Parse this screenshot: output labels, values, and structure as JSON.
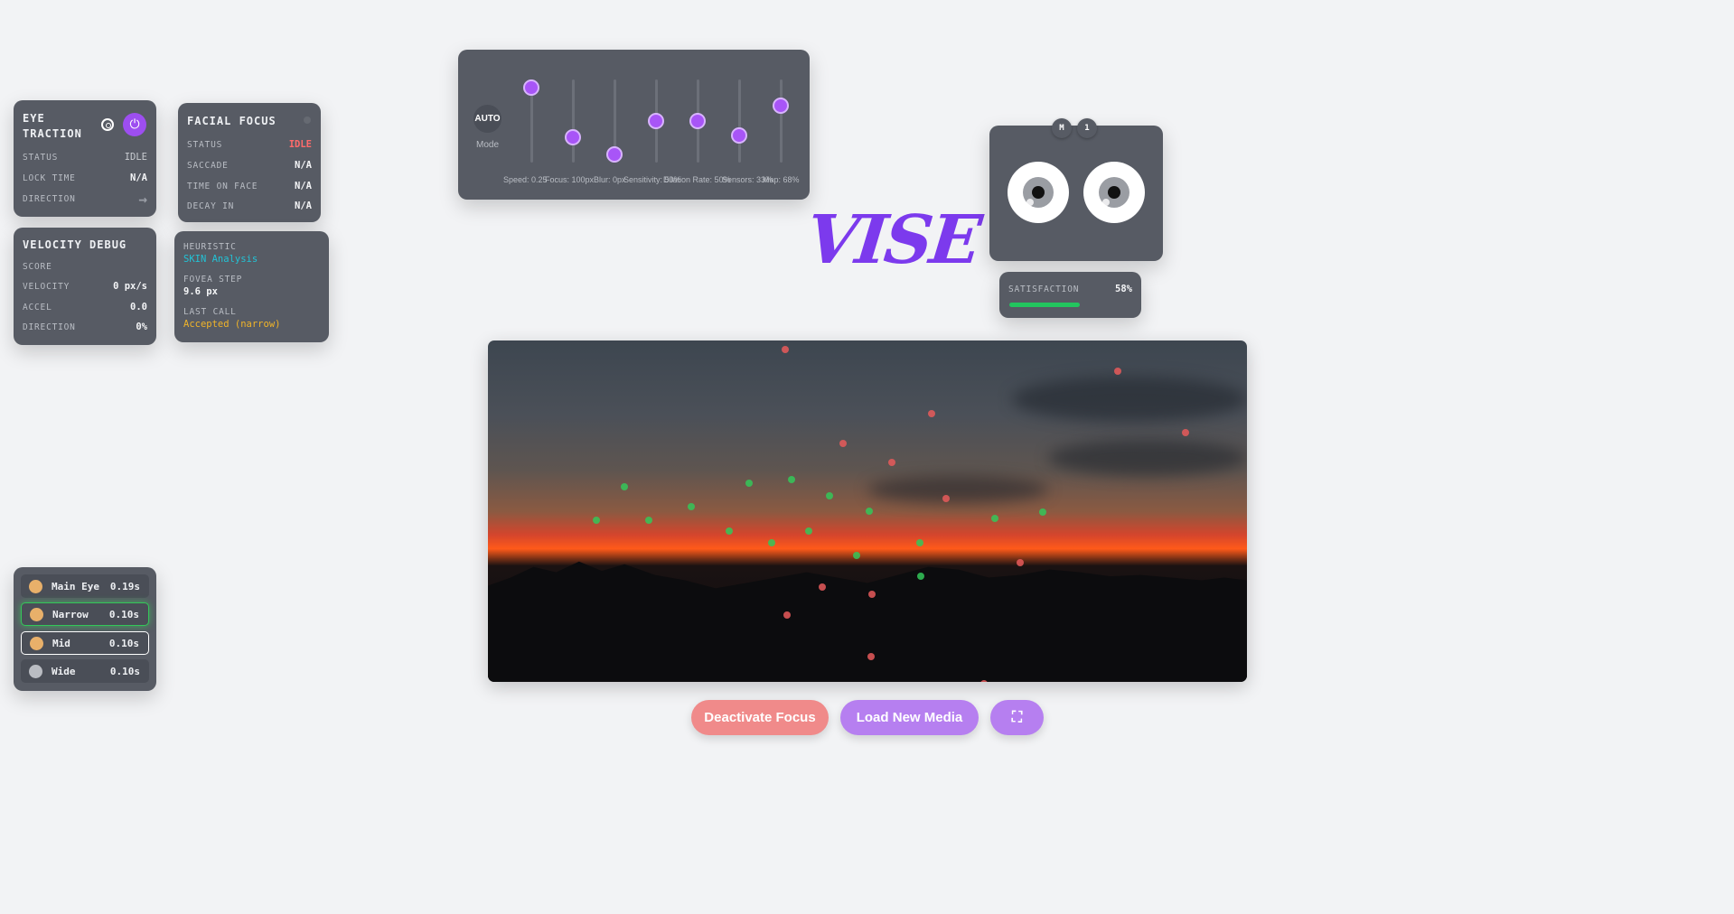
{
  "eye_traction": {
    "title": "EYE TRACTION",
    "rows": [
      {
        "label": "STATUS",
        "value": "IDLE"
      },
      {
        "label": "LOCK TIME",
        "value": "N/A"
      },
      {
        "label": "DIRECTION",
        "value": "→"
      }
    ]
  },
  "facial_focus": {
    "title": "FACIAL FOCUS",
    "rows": [
      {
        "label": "STATUS",
        "value": "IDLE"
      },
      {
        "label": "SACCADE",
        "value": "N/A"
      },
      {
        "label": "TIME ON FACE",
        "value": "N/A"
      },
      {
        "label": "DECAY IN",
        "value": "N/A"
      }
    ]
  },
  "velocity_debug": {
    "title": "VELOCITY DEBUG",
    "rows": [
      {
        "label": "SCORE",
        "value": ""
      },
      {
        "label": "VELOCITY",
        "value": "0 px/s"
      },
      {
        "label": "ACCEL",
        "value": "0.0"
      },
      {
        "label": "DIRECTION",
        "value": "0%"
      }
    ]
  },
  "heuristic": {
    "heuristic_label": "HEURISTIC",
    "heuristic_value": "SKIN Analysis",
    "fovea_label": "FOVEA STEP",
    "fovea_value": "9.6 px",
    "last_call_label": "LAST CALL",
    "last_call_value": "Accepted (narrow)"
  },
  "lenses": [
    {
      "name": "Main Eye",
      "time": "0.19s",
      "color": "#e8b06a"
    },
    {
      "name": "Narrow",
      "time": "0.10s",
      "color": "#e8b06a"
    },
    {
      "name": "Mid",
      "time": "0.10s",
      "color": "#e8b06a"
    },
    {
      "name": "Wide",
      "time": "0.10s",
      "color": "#b9bcc2"
    }
  ],
  "sliders": {
    "auto_label": "AUTO",
    "mode_label": "Mode",
    "items": [
      {
        "label": "Speed: 0.25",
        "level": 0.9
      },
      {
        "label": "Focus: 100px",
        "level": 0.3
      },
      {
        "label": "Blur: 0px",
        "level": 0.1
      },
      {
        "label": "Sensitivity: 50%",
        "level": 0.5
      },
      {
        "label": "Dilation Rate: 50%",
        "level": 0.5
      },
      {
        "label": "Sensors: 33%",
        "level": 0.33
      },
      {
        "label": "Map: 68%",
        "level": 0.68
      }
    ]
  },
  "logo": "VISE",
  "eyes": {
    "tag_m": "M",
    "tag_1": "1"
  },
  "satisfaction": {
    "label": "SATISFACTION",
    "value": "58%",
    "level": 0.58,
    "bar_color": "#22c55e"
  },
  "buttons": {
    "deactivate": "Deactivate Focus",
    "load": "Load New Media",
    "fullscreen_icon": "expand-icon"
  },
  "colors": {
    "accent": "#a855f7",
    "danger": "#f08a8a",
    "status_idle": "#ff6b6b",
    "heuristic": "#22c3d6",
    "last_call": "#f0b429"
  }
}
